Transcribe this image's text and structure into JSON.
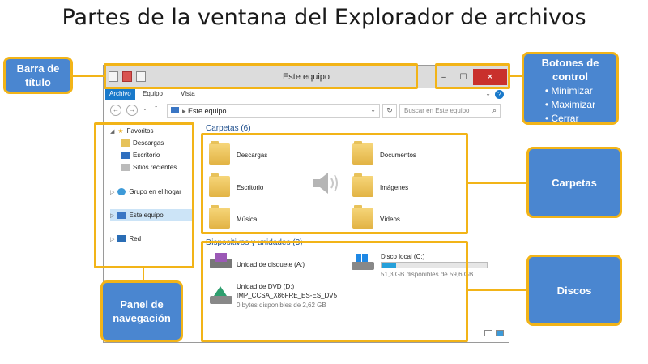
{
  "slide": {
    "title": "Partes de la ventana del Explorador de archivos"
  },
  "window": {
    "title": "Este equipo",
    "controls": {
      "minimize": "–",
      "maximize": "☐",
      "close": "✕"
    },
    "ribbon_tabs": [
      "Archivo",
      "Equipo",
      "Vista"
    ],
    "address": "Este equipo",
    "search_placeholder": "Buscar en Este equipo",
    "nav": {
      "favoritos": "Favoritos",
      "descargas": "Descargas",
      "escritorio": "Escritorio",
      "sitios": "Sitios recientes",
      "grupo": "Grupo en el hogar",
      "equipo": "Este equipo",
      "red": "Red"
    },
    "folders_header": "Carpetas (6)",
    "folders": [
      "Descargas",
      "Documentos",
      "Escritorio",
      "Imágenes",
      "Música",
      "Vídeos"
    ],
    "devices_header": "Dispositivos y unidades (3)",
    "drives": {
      "floppy": "Unidad de disquete (A:)",
      "local_name": "Disco local (C:)",
      "local_free": "51,3 GB disponibles de 59,6 GB",
      "local_used_fraction": 0.14,
      "dvd_name": "Unidad de DVD (D:)",
      "dvd_label": "IMP_CCSA_X86FRE_ES-ES_DV5",
      "dvd_free": "0 bytes disponibles de 2,62 GB"
    }
  },
  "callouts": {
    "barra": "Barra de título",
    "botones": "Botones de control",
    "botones_items": [
      "Minimizar",
      "Maximizar",
      "Cerrar"
    ],
    "carpetas": "Carpetas",
    "panel": "Panel de navegación",
    "discos": "Discos"
  },
  "colors": {
    "accent": "#f2b418",
    "callout": "#4a86d0",
    "close": "#c9302c"
  }
}
